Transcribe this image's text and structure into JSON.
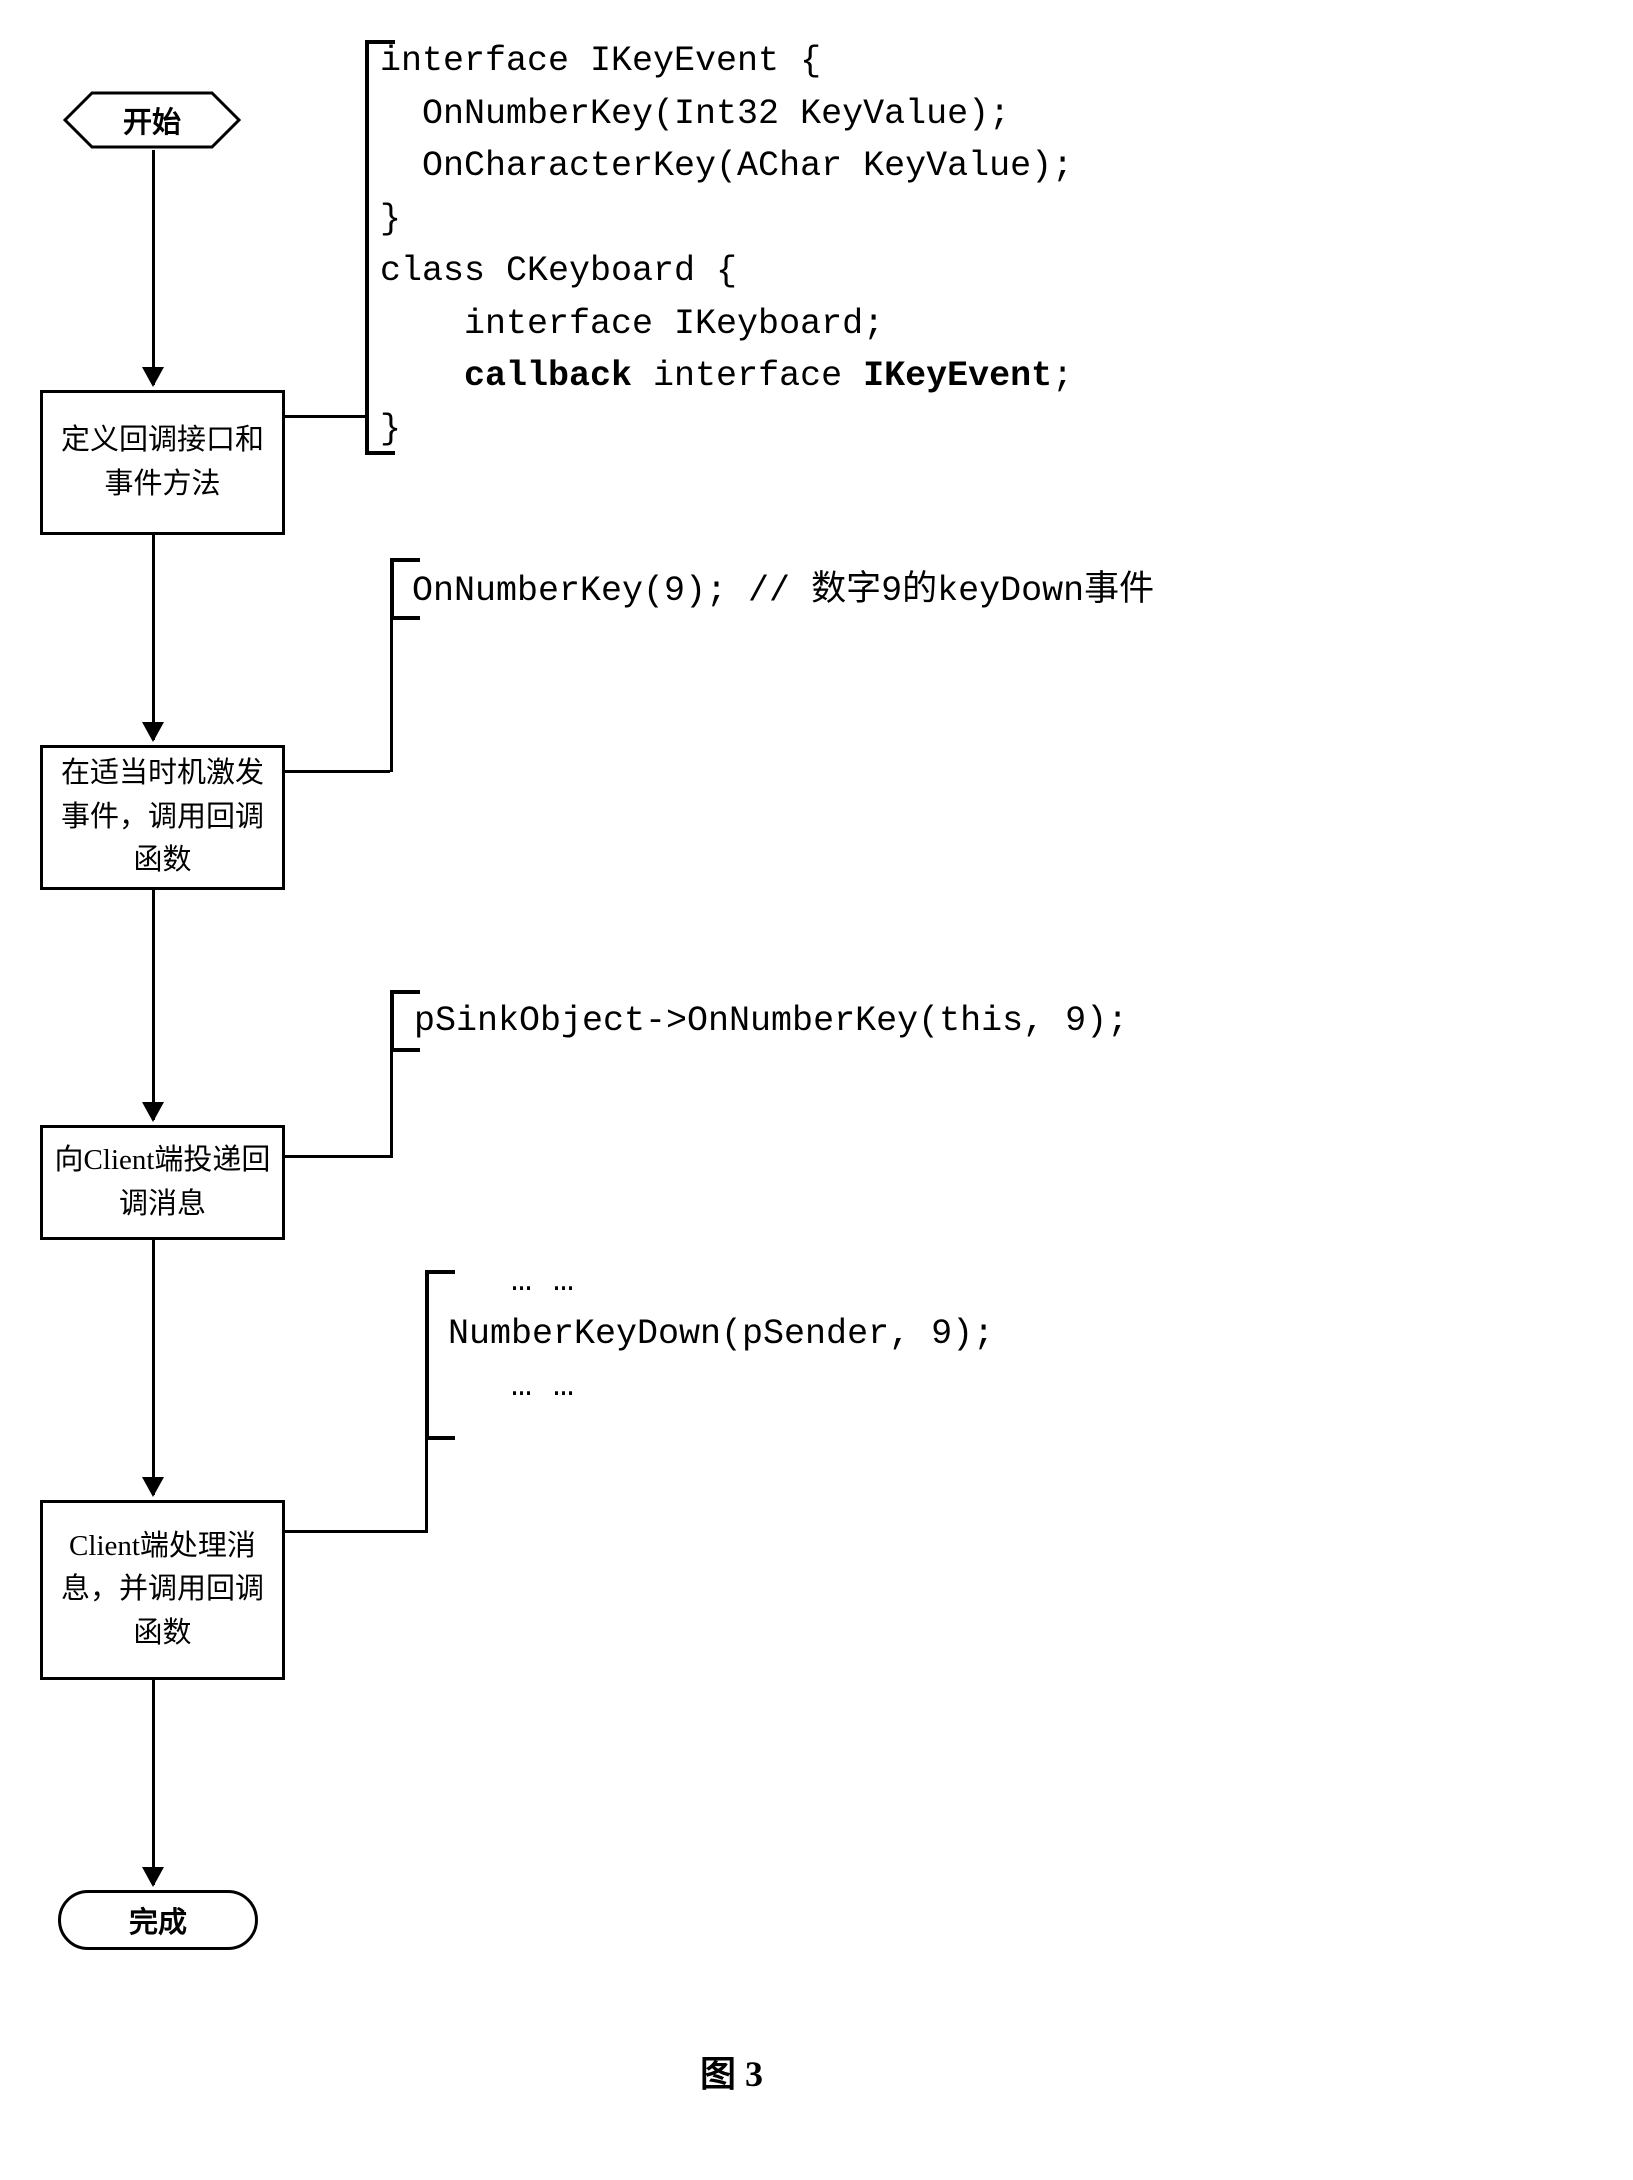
{
  "flowchart": {
    "start": "开始",
    "box1": "定义回调接口和事件方法",
    "box2": "在适当时机激发事件，调用回调函数",
    "box3": "向Client端投递回调消息",
    "box4": "Client端处理消息，并调用回调函数",
    "end": "完成"
  },
  "code_blocks": {
    "block1_line1": "interface IKeyEvent {",
    "block1_line2": "  OnNumberKey(Int32 KeyValue);",
    "block1_line3": "  OnCharacterKey(AChar KeyValue);",
    "block1_line4": "}",
    "block1_line5": "class CKeyboard {",
    "block1_line6": "    interface IKeyboard;",
    "block1_line7_prefix": "    ",
    "block1_line7_bold1": "callback",
    "block1_line7_mid": " interface ",
    "block1_line7_bold2": "IKeyEvent",
    "block1_line7_suffix": ";",
    "block1_line8": "}",
    "block2": "OnNumberKey(9); // 数字9的keyDown事件",
    "block3": "pSinkObject->OnNumberKey(this, 9);",
    "block4_line1": "   … …",
    "block4_line2": "NumberKeyDown(pSender, 9);",
    "block4_line3": "   … …"
  },
  "figure_label": "图 3"
}
